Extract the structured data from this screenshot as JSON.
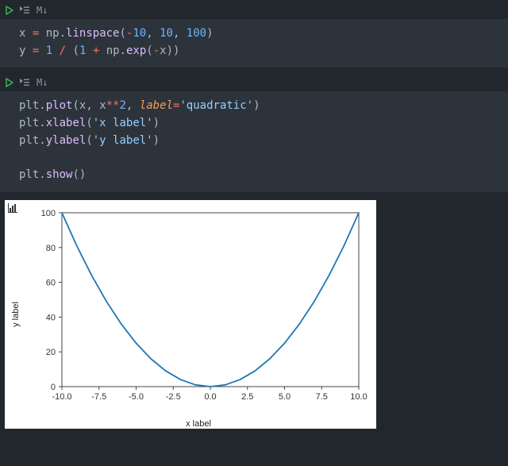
{
  "cells": [
    {
      "toolbar": {
        "markdown_label": "M↓"
      },
      "code_plain": "x = np.linspace(-10, 10, 100)\ny = 1 / (1 + np.exp(-x))",
      "tokens": [
        [
          {
            "t": "x",
            "c": "var"
          },
          {
            "t": " ",
            "c": ""
          },
          {
            "t": "=",
            "c": "op"
          },
          {
            "t": " ",
            "c": ""
          },
          {
            "t": "np",
            "c": "mod"
          },
          {
            "t": ".",
            "c": "dot"
          },
          {
            "t": "linspace",
            "c": "fn"
          },
          {
            "t": "(",
            "c": "var"
          },
          {
            "t": "-",
            "c": "op"
          },
          {
            "t": "10",
            "c": "num"
          },
          {
            "t": ", ",
            "c": "var"
          },
          {
            "t": "10",
            "c": "num"
          },
          {
            "t": ", ",
            "c": "var"
          },
          {
            "t": "100",
            "c": "num"
          },
          {
            "t": ")",
            "c": "var"
          }
        ],
        [
          {
            "t": "y",
            "c": "var"
          },
          {
            "t": " ",
            "c": ""
          },
          {
            "t": "=",
            "c": "op"
          },
          {
            "t": " ",
            "c": ""
          },
          {
            "t": "1",
            "c": "num"
          },
          {
            "t": " ",
            "c": ""
          },
          {
            "t": "/",
            "c": "op"
          },
          {
            "t": " ",
            "c": ""
          },
          {
            "t": "(",
            "c": "var"
          },
          {
            "t": "1",
            "c": "num"
          },
          {
            "t": " ",
            "c": ""
          },
          {
            "t": "+",
            "c": "op"
          },
          {
            "t": " ",
            "c": ""
          },
          {
            "t": "np",
            "c": "mod"
          },
          {
            "t": ".",
            "c": "dot"
          },
          {
            "t": "exp",
            "c": "fn"
          },
          {
            "t": "(",
            "c": "var"
          },
          {
            "t": "-",
            "c": "op"
          },
          {
            "t": "x",
            "c": "var"
          },
          {
            "t": ")",
            "c": "var"
          },
          {
            "t": ")",
            "c": "var"
          }
        ]
      ]
    },
    {
      "toolbar": {
        "markdown_label": "M↓"
      },
      "code_plain": "plt.plot(x, x**2, label='quadratic')\nplt.xlabel('x label')\nplt.ylabel('y label')\n\nplt.show()",
      "tokens": [
        [
          {
            "t": "plt",
            "c": "mod"
          },
          {
            "t": ".",
            "c": "dot"
          },
          {
            "t": "plot",
            "c": "fn"
          },
          {
            "t": "(",
            "c": "var"
          },
          {
            "t": "x",
            "c": "var"
          },
          {
            "t": ", ",
            "c": "var"
          },
          {
            "t": "x",
            "c": "var"
          },
          {
            "t": "**",
            "c": "op"
          },
          {
            "t": "2",
            "c": "num"
          },
          {
            "t": ", ",
            "c": "var"
          },
          {
            "t": "label",
            "c": "kw"
          },
          {
            "t": "=",
            "c": "op"
          },
          {
            "t": "'quadratic'",
            "c": "str"
          },
          {
            "t": ")",
            "c": "var"
          }
        ],
        [
          {
            "t": "plt",
            "c": "mod"
          },
          {
            "t": ".",
            "c": "dot"
          },
          {
            "t": "xlabel",
            "c": "fn"
          },
          {
            "t": "(",
            "c": "var"
          },
          {
            "t": "'x label'",
            "c": "str"
          },
          {
            "t": ")",
            "c": "var"
          }
        ],
        [
          {
            "t": "plt",
            "c": "mod"
          },
          {
            "t": ".",
            "c": "dot"
          },
          {
            "t": "ylabel",
            "c": "fn"
          },
          {
            "t": "(",
            "c": "var"
          },
          {
            "t": "'y label'",
            "c": "str"
          },
          {
            "t": ")",
            "c": "var"
          }
        ],
        [],
        [
          {
            "t": "plt",
            "c": "mod"
          },
          {
            "t": ".",
            "c": "dot"
          },
          {
            "t": "show",
            "c": "fn"
          },
          {
            "t": "(",
            "c": "var"
          },
          {
            "t": ")",
            "c": "var"
          }
        ]
      ]
    }
  ],
  "chart_data": {
    "type": "line",
    "series_label": "quadratic",
    "xlabel": "x label",
    "ylabel": "y label",
    "xlim": [
      -10,
      10
    ],
    "ylim": [
      0,
      100
    ],
    "xticks": [
      -10.0,
      -7.5,
      -5.0,
      -2.5,
      0.0,
      2.5,
      5.0,
      7.5,
      10.0
    ],
    "yticks": [
      0,
      20,
      40,
      60,
      80,
      100
    ],
    "x": [
      -10,
      -9,
      -8,
      -7,
      -6,
      -5,
      -4,
      -3,
      -2,
      -1,
      0,
      1,
      2,
      3,
      4,
      5,
      6,
      7,
      8,
      9,
      10
    ],
    "y": [
      100,
      81,
      64,
      49,
      36,
      25,
      16,
      9,
      4,
      1,
      0,
      1,
      4,
      9,
      16,
      25,
      36,
      49,
      64,
      81,
      100
    ],
    "line_color": "#1f77b4"
  }
}
